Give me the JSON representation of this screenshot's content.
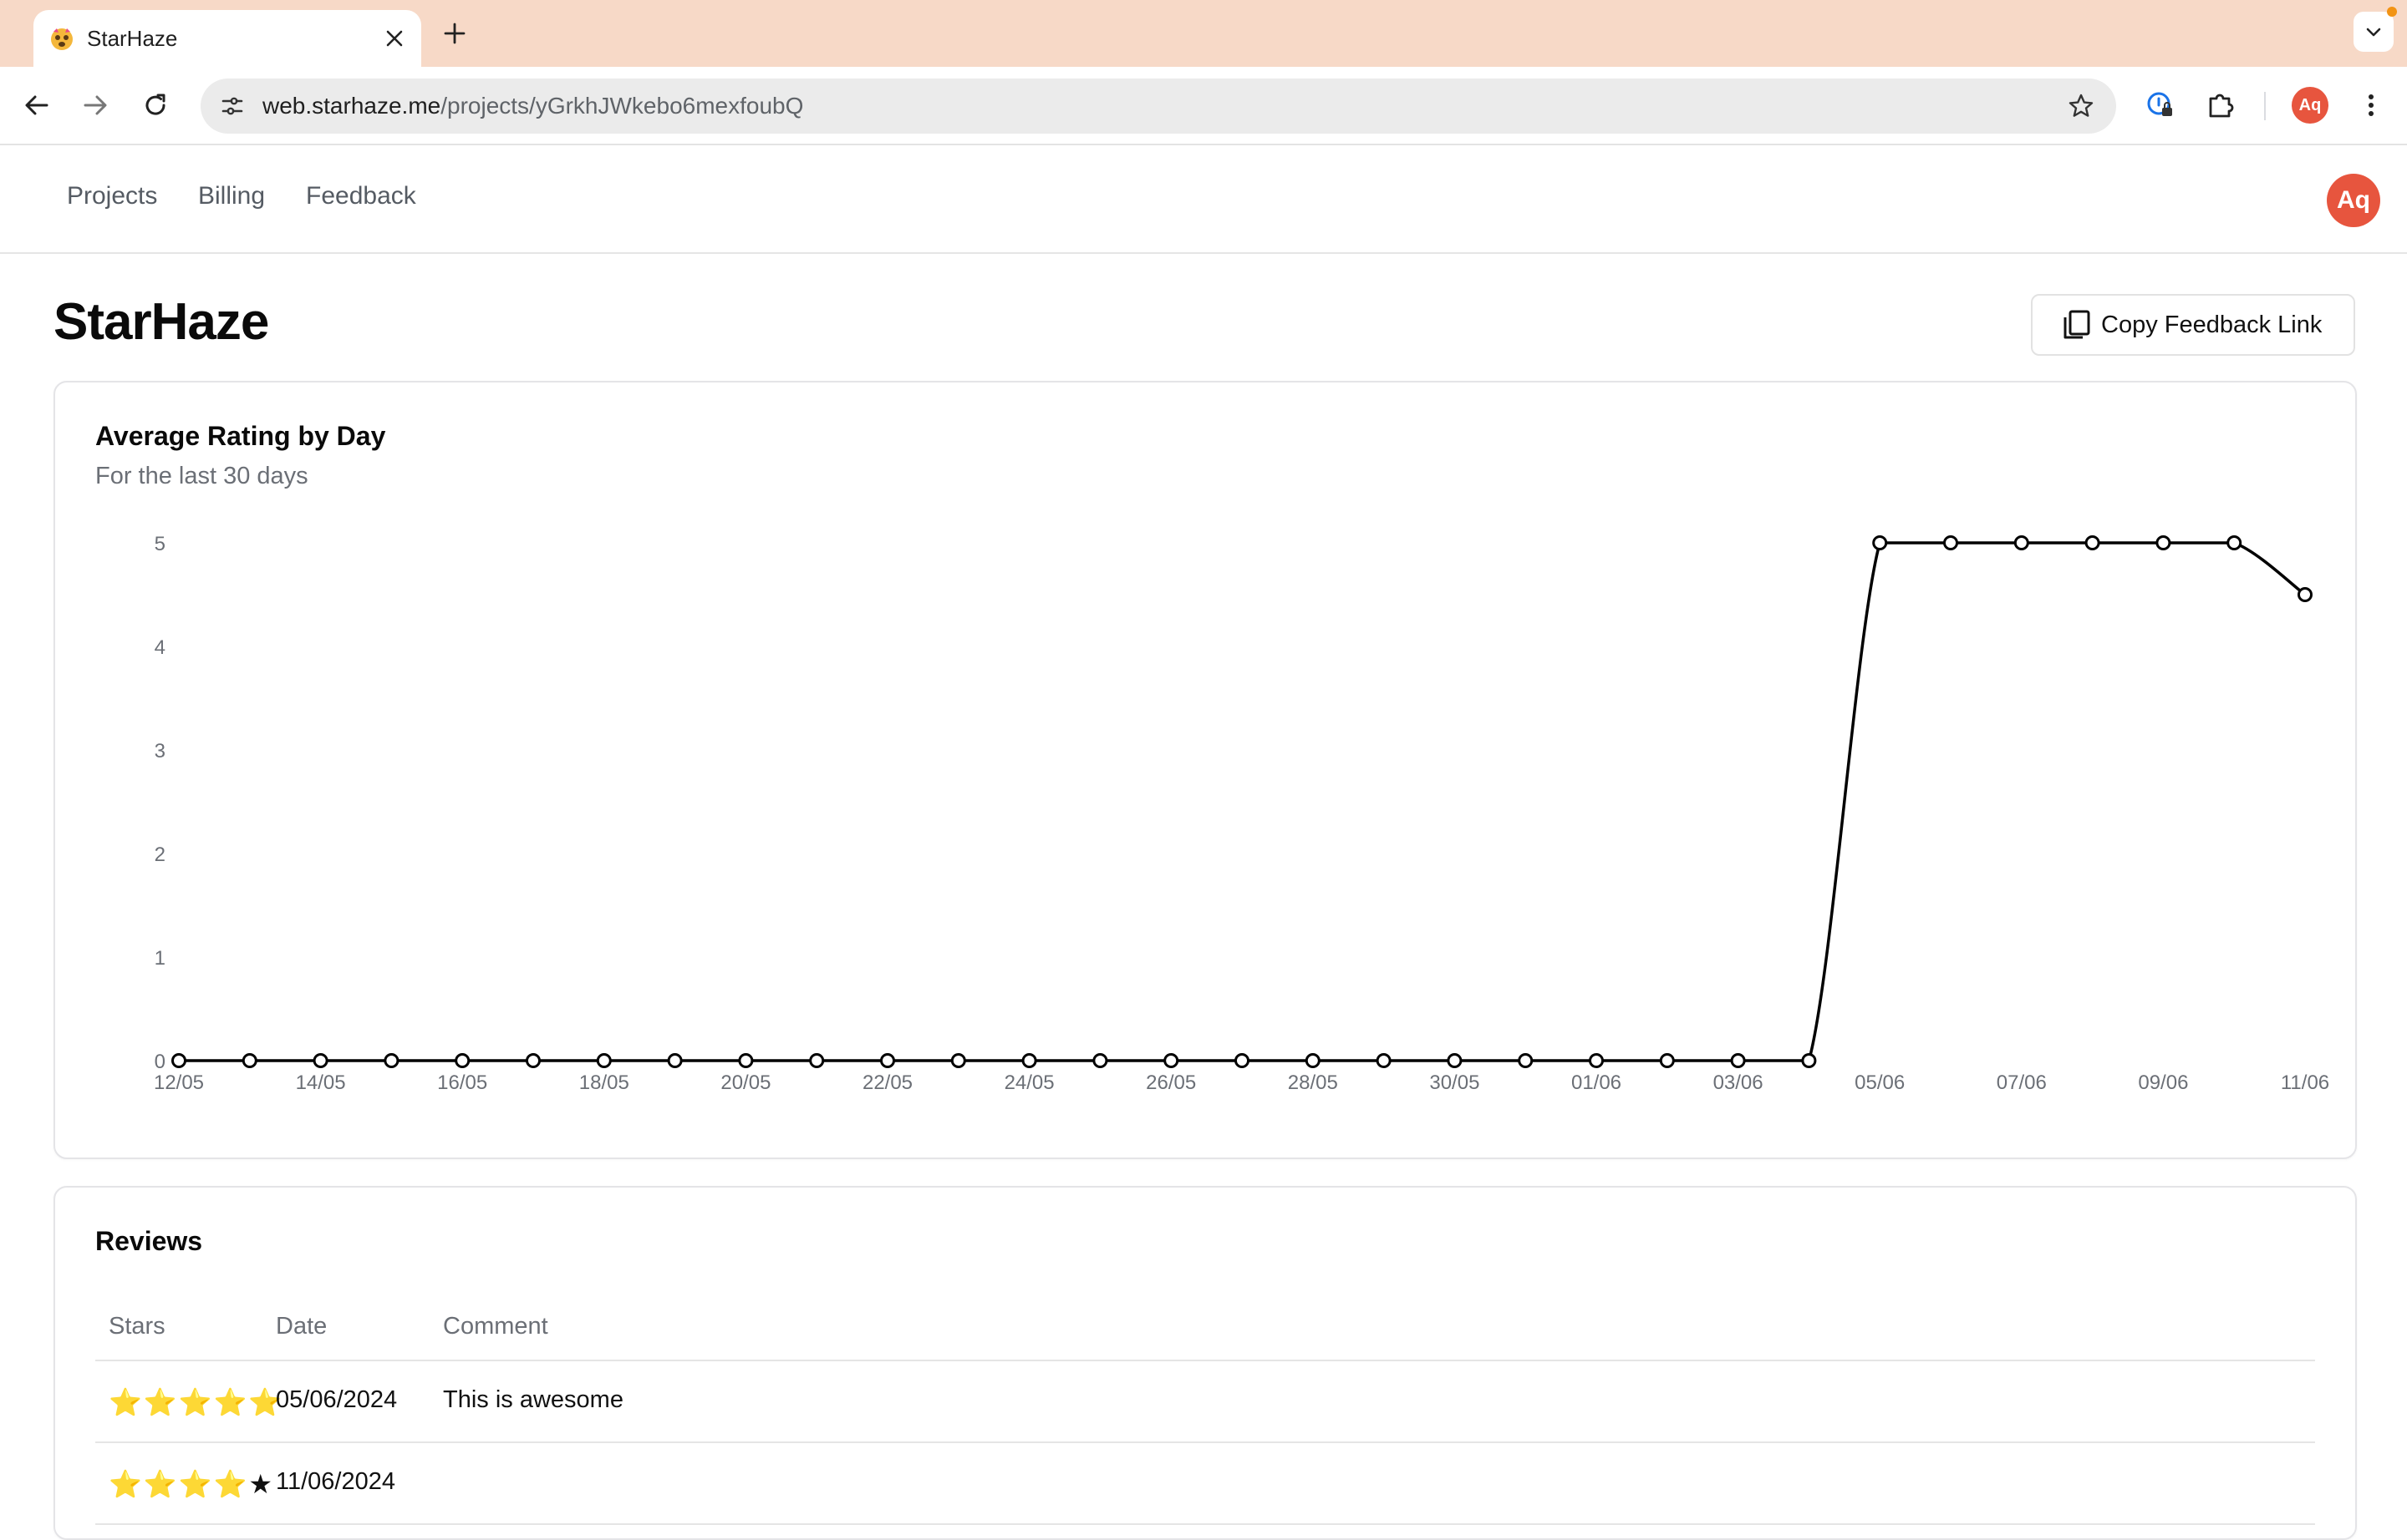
{
  "browser": {
    "tab_title": "StarHaze",
    "url_domain": "web.starhaze.me",
    "url_path": "/projects/yGrkhJWkebo6mexfoubQ",
    "profile_initials": "Aq",
    "icons": [
      "favicon-icon",
      "close-icon",
      "plus-icon",
      "chevron-down-icon",
      "back-arrow-icon",
      "forward-arrow-icon",
      "reload-icon",
      "site-settings-icon",
      "star-icon",
      "password-manager-icon",
      "puzzle-icon",
      "more-vert-icon"
    ]
  },
  "nav": {
    "links": [
      "Projects",
      "Billing",
      "Feedback"
    ],
    "avatar_initials": "Aq"
  },
  "page": {
    "title": "StarHaze",
    "copy_button_label": "Copy Feedback Link"
  },
  "chart": {
    "title": "Average Rating by Day",
    "subtitle": "For the last 30 days"
  },
  "chart_data": {
    "type": "line",
    "title": "Average Rating by Day",
    "subtitle": "For the last 30 days",
    "xlabel": "",
    "ylabel": "",
    "ylim": [
      0,
      5
    ],
    "yticks": [
      0,
      1,
      2,
      3,
      4,
      5
    ],
    "grid": false,
    "x": [
      "12/05",
      "13/05",
      "14/05",
      "15/05",
      "16/05",
      "17/05",
      "18/05",
      "19/05",
      "20/05",
      "21/05",
      "22/05",
      "23/05",
      "24/05",
      "25/05",
      "26/05",
      "27/05",
      "28/05",
      "29/05",
      "30/05",
      "31/05",
      "01/06",
      "02/06",
      "03/06",
      "04/06",
      "05/06",
      "06/06",
      "07/06",
      "08/06",
      "09/06",
      "10/06",
      "11/06"
    ],
    "xticks": [
      "12/05",
      "14/05",
      "16/05",
      "18/05",
      "20/05",
      "22/05",
      "24/05",
      "26/05",
      "28/05",
      "30/05",
      "01/06",
      "03/06",
      "05/06",
      "07/06",
      "09/06",
      "11/06"
    ],
    "series": [
      {
        "values": [
          0,
          0,
          0,
          0,
          0,
          0,
          0,
          0,
          0,
          0,
          0,
          0,
          0,
          0,
          0,
          0,
          0,
          0,
          0,
          0,
          0,
          0,
          0,
          0,
          5,
          5,
          5,
          5,
          5,
          5,
          4.5
        ]
      }
    ],
    "line_color": "#000000"
  },
  "reviews": {
    "title": "Reviews",
    "columns": [
      "Stars",
      "Date",
      "Comment"
    ],
    "rows": [
      {
        "stars": 5,
        "date": "05/06/2024",
        "comment": "This is awesome"
      },
      {
        "stars": 4,
        "date": "11/06/2024",
        "comment": ""
      }
    ]
  }
}
